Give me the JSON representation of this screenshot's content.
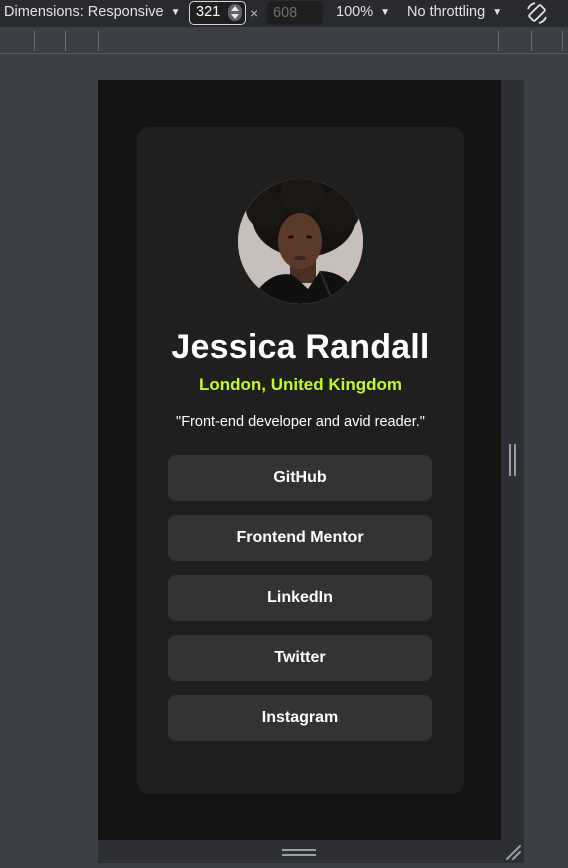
{
  "devtools": {
    "dimensions_label": "Dimensions: Responsive",
    "width_value": "321",
    "times_symbol": "×",
    "height_placeholder": "608",
    "zoom": "100%",
    "throttling": "No throttling",
    "caret": "▼"
  },
  "profile": {
    "name": "Jessica Randall",
    "location": "London, United Kingdom",
    "bio": "\"Front-end developer and avid reader.\"",
    "links": [
      {
        "label": "GitHub"
      },
      {
        "label": "Frontend Mentor"
      },
      {
        "label": "LinkedIn"
      },
      {
        "label": "Twitter"
      },
      {
        "label": "Instagram"
      }
    ]
  },
  "colors": {
    "accent": "#c4f82a",
    "card": "#1f1f1f",
    "button": "#333333",
    "page": "#141414"
  }
}
